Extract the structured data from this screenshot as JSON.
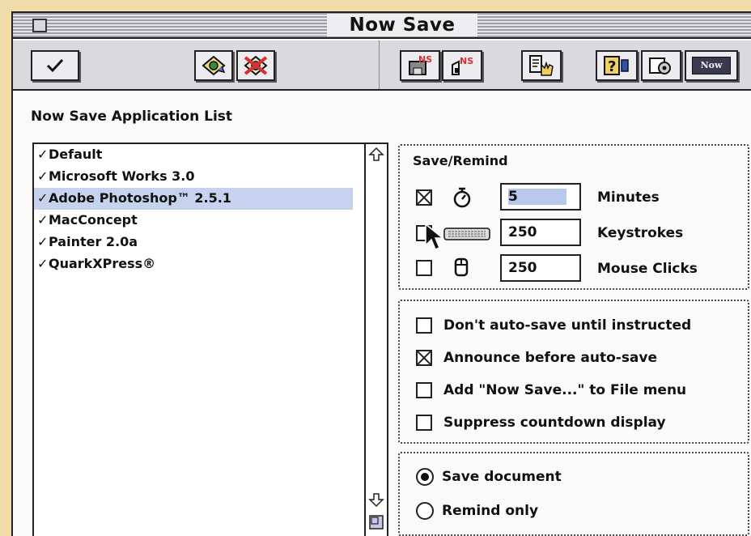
{
  "window": {
    "title": "Now Save"
  },
  "list": {
    "title": "Now Save Application List",
    "check_mark": "✓",
    "items": [
      {
        "label": "Default",
        "selected": false
      },
      {
        "label": "Microsoft Works 3.0",
        "selected": false
      },
      {
        "label": "Adobe Photoshop™ 2.5.1",
        "selected": true
      },
      {
        "label": "MacConcept",
        "selected": false
      },
      {
        "label": "Painter 2.0a",
        "selected": false
      },
      {
        "label": "QuarkXPress®",
        "selected": false
      }
    ]
  },
  "save_remind": {
    "title": "Save/Remind",
    "minutes": {
      "value": "5",
      "label": "Minutes",
      "checked": true
    },
    "keystrokes": {
      "value": "250",
      "label": "Keystrokes",
      "checked": false
    },
    "mouse_clicks": {
      "value": "250",
      "label": "Mouse Clicks",
      "checked": false
    }
  },
  "options": [
    {
      "label": "Don't auto-save until instructed",
      "checked": false
    },
    {
      "label": "Announce before auto-save",
      "checked": true
    },
    {
      "label": "Add \"Now Save...\" to File menu",
      "checked": false
    },
    {
      "label": "Suppress countdown display",
      "checked": false
    }
  ],
  "mode": {
    "save_document": {
      "label": "Save document",
      "selected": true
    },
    "remind_only": {
      "label": "Remind only",
      "selected": false
    }
  },
  "toolbar": {
    "icons": [
      "checkmark-icon",
      "add-app-icon",
      "remove-app-icon",
      "save-stamp-icon",
      "remind-stamp-icon",
      "hand-icon",
      "help-icon",
      "preferences-icon",
      "now-logo-icon"
    ],
    "now_label": "Now"
  },
  "colors": {
    "background": "#f0dcaa",
    "selection": "#c6d2ee",
    "field_highlight": "#b8c8ec"
  }
}
